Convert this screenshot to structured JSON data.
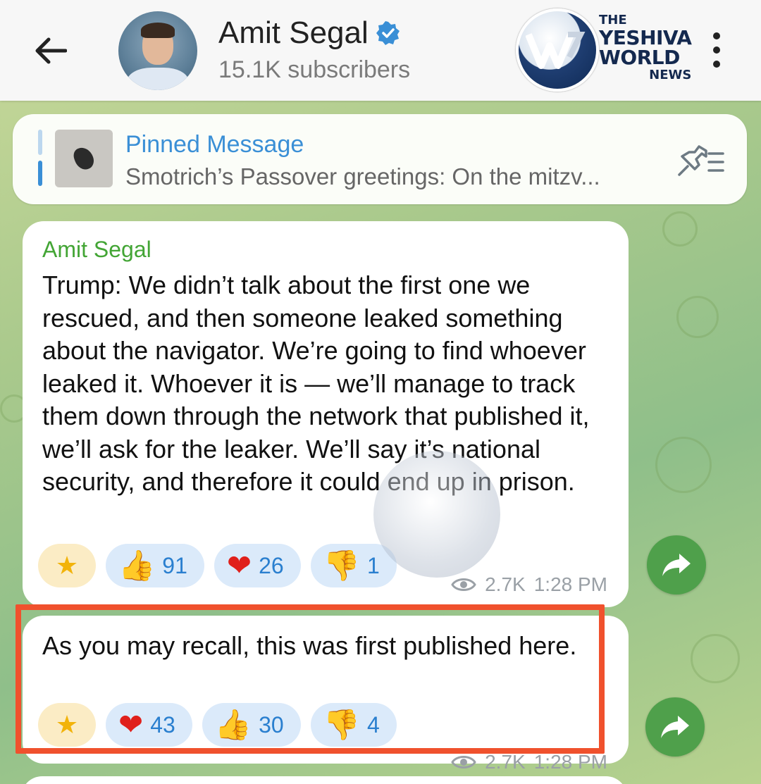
{
  "header": {
    "back_label": "←",
    "channel_name": "Amit Segal",
    "subscribers": "15.1K subscribers",
    "logo": {
      "line1": "THE",
      "line2": "YESHIVA",
      "line3": "WORLD",
      "line4": "NEWS"
    }
  },
  "pinned": {
    "title": "Pinned Message",
    "text": "Smotrich’s Passover greetings:  On the mitzv..."
  },
  "messages": [
    {
      "sender": "Amit Segal",
      "text": "Trump: We didn’t talk about the first one we rescued, and then someone leaked something about the navigator. We’re going to find whoever leaked it. Whoever it is — we’ll manage to track them down through the network that published it, we’ll ask for the leaker. We’ll say it’s national security, and therefore it could end up in prison.",
      "reactions": [
        {
          "emoji": "👍",
          "count": "91"
        },
        {
          "emoji": "❤",
          "count": "26"
        },
        {
          "emoji": "👎",
          "count": "1"
        }
      ],
      "views": "2.7K",
      "time": "1:28 PM"
    },
    {
      "text": "As you may recall, this was first published here.",
      "reactions": [
        {
          "emoji": "❤",
          "count": "43"
        },
        {
          "emoji": "👍",
          "count": "30"
        },
        {
          "emoji": "👎",
          "count": "4"
        }
      ],
      "views": "2.7K",
      "time": "1:28 PM"
    }
  ],
  "colors": {
    "accent_blue": "#3a8fd6",
    "sender_green": "#43a535",
    "share_green": "#4fa04b",
    "highlight_red": "#f0512d"
  }
}
